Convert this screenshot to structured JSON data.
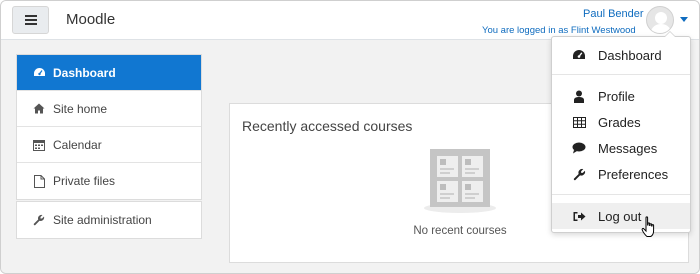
{
  "navbar": {
    "brand": "Moodle",
    "user_name": "Paul Bender",
    "logged_in_as": "You are logged in as Flint Westwood"
  },
  "drawer": {
    "group1": [
      {
        "label": "Dashboard",
        "icon": "dashboard-icon",
        "active": true
      },
      {
        "label": "Site home",
        "icon": "home-icon"
      },
      {
        "label": "Calendar",
        "icon": "calendar-icon"
      },
      {
        "label": "Private files",
        "icon": "file-icon"
      }
    ],
    "group2": [
      {
        "label": "Site administration",
        "icon": "wrench-icon"
      }
    ]
  },
  "main": {
    "block_title": "Recently accessed courses",
    "empty_text": "No recent courses"
  },
  "user_menu": {
    "items": [
      {
        "label": "Dashboard",
        "icon": "dashboard-icon"
      },
      {
        "label": "Profile",
        "icon": "user-icon"
      },
      {
        "label": "Grades",
        "icon": "table-icon"
      },
      {
        "label": "Messages",
        "icon": "comment-icon"
      },
      {
        "label": "Preferences",
        "icon": "wrench-icon"
      },
      {
        "label": "Log out",
        "icon": "sign-out-icon"
      }
    ]
  },
  "colors": {
    "accent": "#1177d1",
    "link": "#0f6cbf",
    "page_bg": "#f2f2f2"
  }
}
